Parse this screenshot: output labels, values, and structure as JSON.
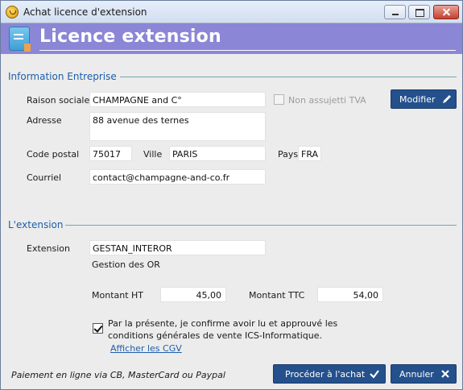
{
  "window": {
    "title": "Achat licence d'extension"
  },
  "banner": {
    "title": "Licence extension"
  },
  "entreprise": {
    "section_title": "Information Entreprise",
    "raison_sociale_label": "Raison sociale",
    "raison_sociale_value": "CHAMPAGNE and C°",
    "tva_label": "Non assujetti TVA",
    "tva_checked": false,
    "modifier_label": "Modifier",
    "adresse_label": "Adresse",
    "adresse_value": "88 avenue des ternes",
    "code_postal_label": "Code postal",
    "code_postal_value": "75017",
    "ville_label": "Ville",
    "ville_value": "PARIS",
    "pays_label": "Pays",
    "pays_value": "FRA",
    "courriel_label": "Courriel",
    "courriel_value": "contact@champagne-and-co.fr"
  },
  "extension": {
    "section_title": "L'extension",
    "extension_label": "Extension",
    "extension_value": "GESTAN_INTEROR",
    "extension_description": "Gestion des OR",
    "montant_ht_label": "Montant HT",
    "montant_ht_value": "45,00",
    "montant_ttc_label": "Montant TTC",
    "montant_ttc_value": "54,00",
    "cgv_line1": "Par la présente, je confirme avoir lu et approuvé les",
    "cgv_line2": "conditions générales de vente ICS-Informatique.",
    "cgv_checked": true,
    "cgv_link": "Afficher les CGV"
  },
  "footer": {
    "payment_note": "Paiement en ligne via CB, MasterCard ou Paypal",
    "proceed_label": "Procéder à l'achat",
    "cancel_label": "Annuler"
  },
  "colors": {
    "banner": "#8b86d6",
    "section_title": "#1e5ea8",
    "button": "#24508c",
    "rule": "#6ea8b4"
  }
}
